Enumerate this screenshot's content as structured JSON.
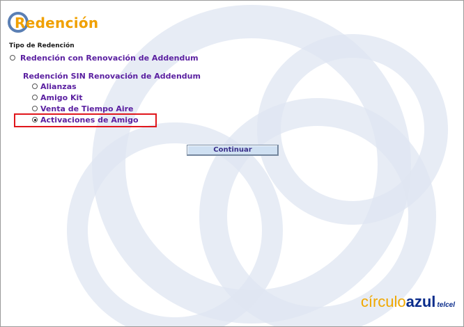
{
  "app": {
    "title": "Redención"
  },
  "form": {
    "section_label": "Tipo de Redención",
    "option_top": {
      "label": "Redención con Renovación de Addendum",
      "selected": false
    },
    "sub_heading": "Redención SIN Renovación de Addendum",
    "sub_options": [
      {
        "label": "Alianzas",
        "selected": false
      },
      {
        "label": "Amigo Kit",
        "selected": false
      },
      {
        "label": "Venta de Tiempo Aire",
        "selected": false
      },
      {
        "label": "Activaciones de Amigo",
        "selected": true
      }
    ],
    "submit_label": "Continuar"
  },
  "brand": {
    "part1": "círculo",
    "part2": "azul",
    "part3": "telcel"
  },
  "colors": {
    "title": "#f0a000",
    "option_text": "#5a1fa0",
    "highlight": "#e0161b",
    "button_bg": "#cfe0f2"
  }
}
